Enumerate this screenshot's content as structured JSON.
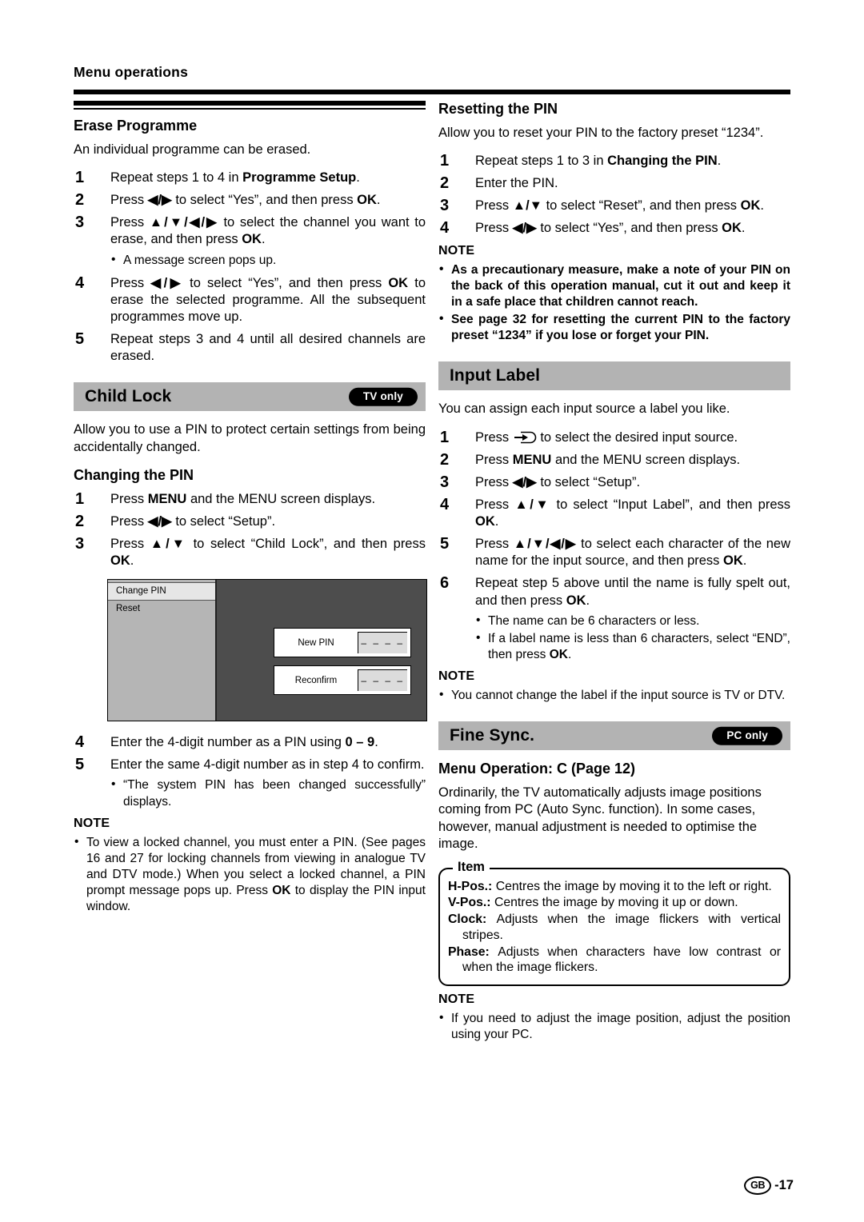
{
  "running_head": "Menu operations",
  "footer": {
    "mark": "GB",
    "page": "-17"
  },
  "left_column": {
    "erase_programme": {
      "heading": "Erase Programme",
      "intro": "An individual programme can be erased.",
      "steps": [
        {
          "num": "1",
          "html": "Repeat steps 1 to 4 in <b>Programme Setup</b>."
        },
        {
          "num": "2",
          "html": "Press <b>◀/▶</b> to select “Yes”, and then press <b>OK</b>."
        },
        {
          "num": "3",
          "html": "Press <b>▲/▼/◀/▶</b> to select the channel you want to erase, and then press <b>OK</b>.",
          "bullets": [
            "A message screen pops up."
          ]
        },
        {
          "num": "4",
          "html": "Press <b>◀/▶</b> to select “Yes”, and then press <b>OK</b> to erase the selected programme. All the subsequent programmes move up."
        },
        {
          "num": "5",
          "html": "Repeat steps 3 and 4 until all desired channels are erased."
        }
      ]
    },
    "child_lock": {
      "title": "Child Lock",
      "badge": "TV only",
      "intro": "Allow you to use a PIN to protect certain settings from being accidentally changed.",
      "changing_pin": {
        "heading": "Changing the PIN",
        "steps_before": [
          {
            "num": "1",
            "html": "Press <b>MENU</b> and the MENU screen displays."
          },
          {
            "num": "2",
            "html": "Press <b>◀/▶</b> to select “Setup”."
          },
          {
            "num": "3",
            "html": "Press <b>▲/▼</b> to select “Child Lock”, and then press <b>OK</b>."
          }
        ],
        "osd": {
          "menu_items": [
            "Change PIN",
            "Reset"
          ],
          "fields": [
            {
              "label": "New PIN",
              "value": "– – – –"
            },
            {
              "label": "Reconfirm",
              "value": "– – – –"
            }
          ]
        },
        "steps_after": [
          {
            "num": "4",
            "html": "Enter the 4-digit number as a PIN using <b>0 – 9</b>."
          },
          {
            "num": "5",
            "html": "Enter the same 4-digit number as in step 4 to confirm.",
            "bullets": [
              "“The system PIN has been changed successfully” displays."
            ]
          }
        ],
        "note_label": "NOTE",
        "notes": [
          "To view a locked channel, you must enter a PIN. (See pages 16 and 27 for locking channels from viewing in analogue TV and DTV mode.) When you select a locked channel, a PIN prompt message pops up. Press <b>OK</b> to display the PIN input window."
        ]
      }
    }
  },
  "right_column": {
    "resetting_pin": {
      "heading": "Resetting the PIN",
      "intro": "Allow you to reset your PIN to the factory preset “1234”.",
      "steps": [
        {
          "num": "1",
          "html": "Repeat steps 1 to 3 in <b>Changing the PIN</b>."
        },
        {
          "num": "2",
          "html": "Enter the PIN."
        },
        {
          "num": "3",
          "html": "Press <b>▲/▼</b> to select “Reset”, and then press <b>OK</b>."
        },
        {
          "num": "4",
          "html": "Press <b>◀/▶</b> to select “Yes”, and then press <b>OK</b>."
        }
      ],
      "note_label": "NOTE",
      "notes": [
        "As a precautionary measure, make a note of your PIN on the back of this operation manual, cut it out and keep it in a safe place that children cannot reach.",
        "See page 32 for resetting the current PIN to the factory preset “1234” if you lose or forget your PIN."
      ]
    },
    "input_label": {
      "title": "Input Label",
      "intro": "You can assign each input source a label you like.",
      "steps": [
        {
          "num": "1",
          "html": "Press <span class=\"ico-input\" data-name=\"input-source-icon\"><svg width=\"30\" height=\"16\" viewBox=\"0 0 30 16\"><path d=\"M2 8 H14\" stroke=\"#000\" stroke-width=\"2\" fill=\"none\"/><path d=\"M12 4 L19 8 L12 12 Z\" fill=\"#000\"/><path d=\"M10 1.5 H22 A6.5 6.5 0 0 1 22 14.5 H10\" stroke=\"#000\" stroke-width=\"1.6\" fill=\"none\"/></svg></span> to select the desired input source."
        },
        {
          "num": "2",
          "html": "Press <b>MENU</b> and the MENU screen displays."
        },
        {
          "num": "3",
          "html": "Press <b>◀/▶</b> to select “Setup”."
        },
        {
          "num": "4",
          "html": "Press <b>▲/▼</b> to select “Input Label”, and then press <b>OK</b>."
        },
        {
          "num": "5",
          "html": "Press <b>▲/▼/◀/▶</b> to select each character of the new name for the input source, and then press <b>OK</b>."
        },
        {
          "num": "6",
          "html": "Repeat step 5 above until the name is fully spelt out, and then press <b>OK</b>.",
          "bullets": [
            "The name can be 6 characters or less.",
            "If a label name is less than 6 characters, select “END”, then press <b>OK</b>."
          ]
        }
      ],
      "note_label": "NOTE",
      "notes": [
        "You cannot change the label if the input source is TV or DTV."
      ]
    },
    "fine_sync": {
      "title": "Fine Sync.",
      "badge": "PC only",
      "menu_operation": "Menu Operation: C (Page 12)",
      "intro": "Ordinarily, the TV automatically adjusts image positions coming from PC (Auto Sync. function). In some cases, however, manual adjustment is needed to optimise the image.",
      "item_box": {
        "legend": "Item",
        "rows": [
          {
            "key": "H-Pos.:",
            "text": "Centres the image by moving it to the left or right."
          },
          {
            "key": "V-Pos.:",
            "text": "Centres the image by moving it up or down."
          },
          {
            "key": "Clock:",
            "text": "Adjusts when the image flickers with vertical stripes."
          },
          {
            "key": "Phase:",
            "text": "Adjusts when characters have low contrast or when the image flickers."
          }
        ]
      },
      "note_label": "NOTE",
      "notes": [
        "If you need to adjust the image position, adjust the position using your PC."
      ]
    }
  }
}
